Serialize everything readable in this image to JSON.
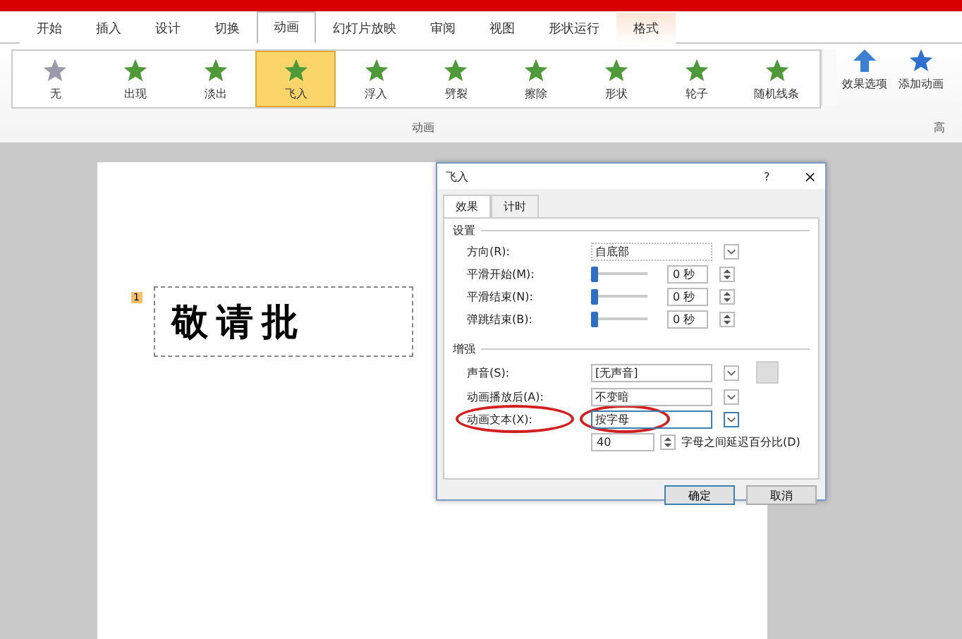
{
  "ribbon_tabs": [
    {
      "label": "开始",
      "selected": false
    },
    {
      "label": "插入",
      "selected": false
    },
    {
      "label": "设计",
      "selected": false
    },
    {
      "label": "切换",
      "selected": false
    },
    {
      "label": "动画",
      "selected": true
    },
    {
      "label": "幻灯片放映",
      "selected": false
    },
    {
      "label": "审阅",
      "selected": false
    },
    {
      "label": "视图",
      "selected": false
    },
    {
      "label": "形状运行",
      "selected": false
    },
    {
      "label": "格式",
      "selected": false,
      "kind": "contextual"
    }
  ],
  "effects": [
    {
      "label": "无",
      "selected": false,
      "kind": "none"
    },
    {
      "label": "出现",
      "selected": false,
      "kind": "effect"
    },
    {
      "label": "淡出",
      "selected": false,
      "kind": "effect"
    },
    {
      "label": "飞入",
      "selected": true,
      "kind": "effect"
    },
    {
      "label": "浮入",
      "selected": false,
      "kind": "effect"
    },
    {
      "label": "劈裂",
      "selected": false,
      "kind": "effect"
    },
    {
      "label": "擦除",
      "selected": false,
      "kind": "effect"
    },
    {
      "label": "形状",
      "selected": false,
      "kind": "effect"
    },
    {
      "label": "轮子",
      "selected": false,
      "kind": "effect"
    },
    {
      "label": "随机线条",
      "selected": false,
      "kind": "effect"
    }
  ],
  "effect_options": "效果选项",
  "add_animation": "添加动画",
  "group_label": "动画",
  "next_group_label": "高",
  "slide": {
    "tag": "1",
    "text": "敬请批"
  },
  "dialog": {
    "title": "飞入",
    "help": "?",
    "close": "×",
    "tabs": [
      {
        "label": "效果",
        "selected": true
      },
      {
        "label": "计时",
        "selected": false
      }
    ],
    "settings_heading": "设置",
    "direction": {
      "label": "方向(R):",
      "value": "自底部"
    },
    "sliders": [
      {
        "label": "平滑开始(M):",
        "value": "0 秒",
        "level": 0
      },
      {
        "label": "平滑结束(N):",
        "value": "0 秒",
        "level": 0
      },
      {
        "label": "弹跳结束(B):",
        "value": "0 秒",
        "level": 0
      }
    ],
    "enhance_heading": "增强",
    "dropdowns": [
      {
        "label": "声音(S):",
        "value": "[无声音]",
        "highlighted": false,
        "kind": "sound"
      },
      {
        "label": "动画播放后(A):",
        "value": "不变暗",
        "highlighted": false,
        "kind": "plain"
      },
      {
        "label": "动画文本(X):",
        "value": "按字母",
        "highlighted": true,
        "kind": "plain"
      }
    ],
    "delay": {
      "value": "40",
      "label": "字母之间延迟百分比(D)"
    },
    "buttons": [
      "确定",
      "取消"
    ]
  }
}
